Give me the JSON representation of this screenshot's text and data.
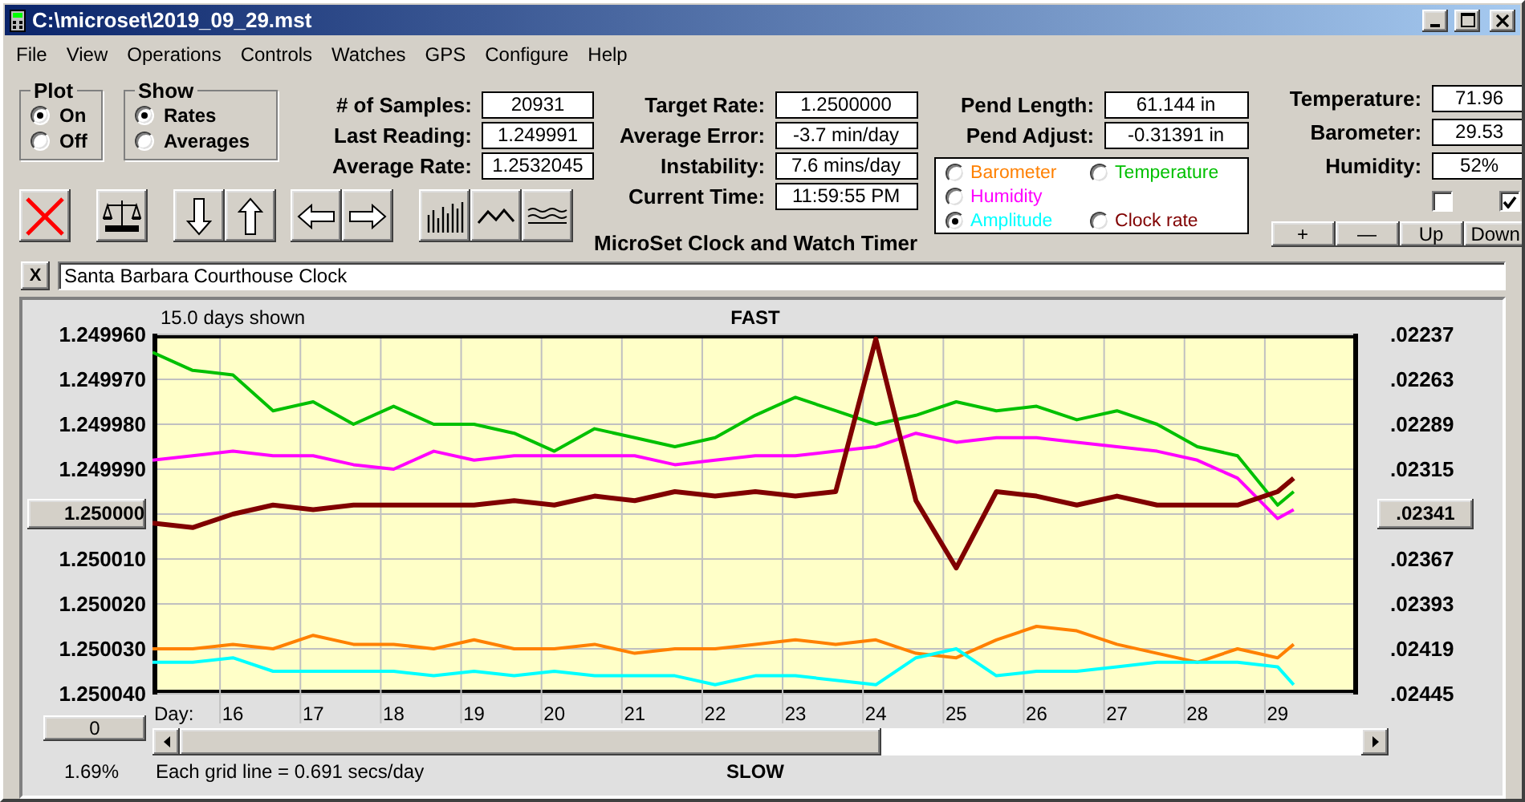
{
  "window": {
    "title": "C:\\microset\\2019_09_29.mst"
  },
  "menu": [
    "File",
    "View",
    "Operations",
    "Controls",
    "Watches",
    "GPS",
    "Configure",
    "Help"
  ],
  "plot_group": {
    "title": "Plot",
    "options": [
      {
        "label": "On",
        "selected": true
      },
      {
        "label": "Off",
        "selected": false
      }
    ]
  },
  "show_group": {
    "title": "Show",
    "options": [
      {
        "label": "Rates",
        "selected": true
      },
      {
        "label": "Averages",
        "selected": false
      }
    ]
  },
  "sample_stats": [
    {
      "label": "# of Samples:",
      "value": "20931"
    },
    {
      "label": "Last Reading:",
      "value": "1.249991"
    },
    {
      "label": "Average Rate:",
      "value": "1.2532045"
    }
  ],
  "rate_stats": [
    {
      "label": "Target Rate:",
      "value": "1.2500000"
    },
    {
      "label": "Average Error:",
      "value": "-3.7 min/day"
    },
    {
      "label": "Instability:",
      "value": "7.6 mins/day"
    },
    {
      "label": "Current Time:",
      "value": "11:59:55 PM"
    }
  ],
  "caption": "MicroSet Clock and Watch Timer",
  "pendulum_stats": [
    {
      "label": "Pend Length:",
      "value": "61.144 in"
    },
    {
      "label": "Pend Adjust:",
      "value": "-0.31391 in"
    }
  ],
  "trace_selector": [
    {
      "label": "Barometer",
      "color": "#ff8000",
      "selected": false
    },
    {
      "label": "Temperature",
      "color": "#00c000",
      "selected": false
    },
    {
      "label": "Humidity",
      "color": "#ff00ff",
      "selected": false
    },
    {
      "label": "Amplitude",
      "color": "#00ffff",
      "selected": true
    },
    {
      "label": "Clock rate",
      "color": "#800000",
      "selected": false
    }
  ],
  "weather_stats": [
    {
      "label": "Temperature:",
      "value": "71.96"
    },
    {
      "label": "Barometer:",
      "value": "29.53"
    },
    {
      "label": "Humidity:",
      "value": "52%"
    }
  ],
  "weather_checkboxes": [
    {
      "checked": false
    },
    {
      "checked": true
    }
  ],
  "adjust_buttons": [
    "+",
    "—",
    "Up",
    "Down"
  ],
  "clear_button": "X",
  "clock_name": {
    "value": "Santa Barbara Courthouse Clock"
  },
  "chart": {
    "days_shown": "15.0 days shown",
    "top_label": "FAST",
    "bottom_label": "SLOW",
    "day_label": "Day:",
    "zero_button": "0",
    "percent": "1.69%",
    "grid_note": "Each grid line = 0.691 secs/day",
    "right_axis_labels": [
      ".02237",
      ".02263",
      ".02289",
      ".02315",
      ".02367",
      ".02393",
      ".02419",
      ".02445"
    ],
    "right_center_button": ".02341",
    "chart_data": {
      "type": "line",
      "grid": true,
      "xlim": [
        15,
        30
      ],
      "ylim": [
        1.25004,
        1.24996
      ],
      "yticks": [
        {
          "value": 1.24996,
          "label": "1.249960"
        },
        {
          "value": 1.24997,
          "label": "1.249970"
        },
        {
          "value": 1.24998,
          "label": "1.249980"
        },
        {
          "value": 1.24999,
          "label": "1.249990"
        },
        {
          "value": 1.25,
          "label": "1.250000"
        },
        {
          "value": 1.25001,
          "label": "1.250010"
        },
        {
          "value": 1.25002,
          "label": "1.250020"
        },
        {
          "value": 1.25003,
          "label": "1.250030"
        },
        {
          "value": 1.25004,
          "label": "1.250040"
        }
      ],
      "xticks": [
        {
          "value": 16,
          "label": "16"
        },
        {
          "value": 17,
          "label": "17"
        },
        {
          "value": 18,
          "label": "18"
        },
        {
          "value": 19,
          "label": "19"
        },
        {
          "value": 20,
          "label": "20"
        },
        {
          "value": 21,
          "label": "21"
        },
        {
          "value": 22,
          "label": "22"
        },
        {
          "value": 23,
          "label": "23"
        },
        {
          "value": 24,
          "label": "24"
        },
        {
          "value": 25,
          "label": "25"
        },
        {
          "value": 26,
          "label": "26"
        },
        {
          "value": 27,
          "label": "27"
        },
        {
          "value": 28,
          "label": "28"
        },
        {
          "value": 29,
          "label": "29"
        }
      ],
      "x": [
        15,
        15.5,
        16,
        16.5,
        17,
        17.5,
        18,
        18.5,
        19,
        19.5,
        20,
        20.5,
        21,
        21.5,
        22,
        22.5,
        23,
        23.5,
        24,
        24.5,
        25,
        25.5,
        26,
        26.5,
        27,
        27.5,
        28,
        28.5,
        29,
        29.2
      ],
      "series": [
        {
          "color": "#00c000",
          "values": [
            1.249964,
            1.249968,
            1.249969,
            1.249977,
            1.249975,
            1.24998,
            1.249976,
            1.24998,
            1.24998,
            1.249982,
            1.249986,
            1.249981,
            1.249983,
            1.249985,
            1.249983,
            1.249978,
            1.249974,
            1.249977,
            1.24998,
            1.249978,
            1.249975,
            1.249977,
            1.249976,
            1.249979,
            1.249977,
            1.24998,
            1.249985,
            1.249987,
            1.249998,
            1.249995
          ]
        },
        {
          "color": "#ff00ff",
          "values": [
            1.249988,
            1.249987,
            1.249986,
            1.249987,
            1.249987,
            1.249989,
            1.24999,
            1.249986,
            1.249988,
            1.249987,
            1.249987,
            1.249987,
            1.249987,
            1.249989,
            1.249988,
            1.249987,
            1.249987,
            1.249986,
            1.249985,
            1.249982,
            1.249984,
            1.249983,
            1.249983,
            1.249984,
            1.249985,
            1.249986,
            1.249988,
            1.249992,
            1.250001,
            1.249999
          ]
        },
        {
          "color": "#800000",
          "values": [
            1.250002,
            1.250003,
            1.25,
            1.249998,
            1.249999,
            1.249998,
            1.249998,
            1.249998,
            1.249998,
            1.249997,
            1.249998,
            1.249996,
            1.249997,
            1.249995,
            1.249996,
            1.249995,
            1.249996,
            1.249995,
            1.249961,
            1.249997,
            1.250012,
            1.249995,
            1.249996,
            1.249998,
            1.249996,
            1.249998,
            1.249998,
            1.249998,
            1.249995,
            1.249992
          ]
        },
        {
          "color": "#ff8000",
          "values": [
            1.25003,
            1.25003,
            1.250029,
            1.25003,
            1.250027,
            1.250029,
            1.250029,
            1.25003,
            1.250028,
            1.25003,
            1.25003,
            1.250029,
            1.250031,
            1.25003,
            1.25003,
            1.250029,
            1.250028,
            1.250029,
            1.250028,
            1.250031,
            1.250032,
            1.250028,
            1.250025,
            1.250026,
            1.250029,
            1.250031,
            1.250033,
            1.25003,
            1.250032,
            1.250029
          ]
        },
        {
          "color": "#00ffff",
          "values": [
            1.250033,
            1.250033,
            1.250032,
            1.250035,
            1.250035,
            1.250035,
            1.250035,
            1.250036,
            1.250035,
            1.250036,
            1.250035,
            1.250036,
            1.250036,
            1.250036,
            1.250038,
            1.250036,
            1.250036,
            1.250037,
            1.250038,
            1.250032,
            1.25003,
            1.250036,
            1.250035,
            1.250035,
            1.250034,
            1.250033,
            1.250033,
            1.250033,
            1.250034,
            1.250038
          ]
        }
      ]
    }
  }
}
